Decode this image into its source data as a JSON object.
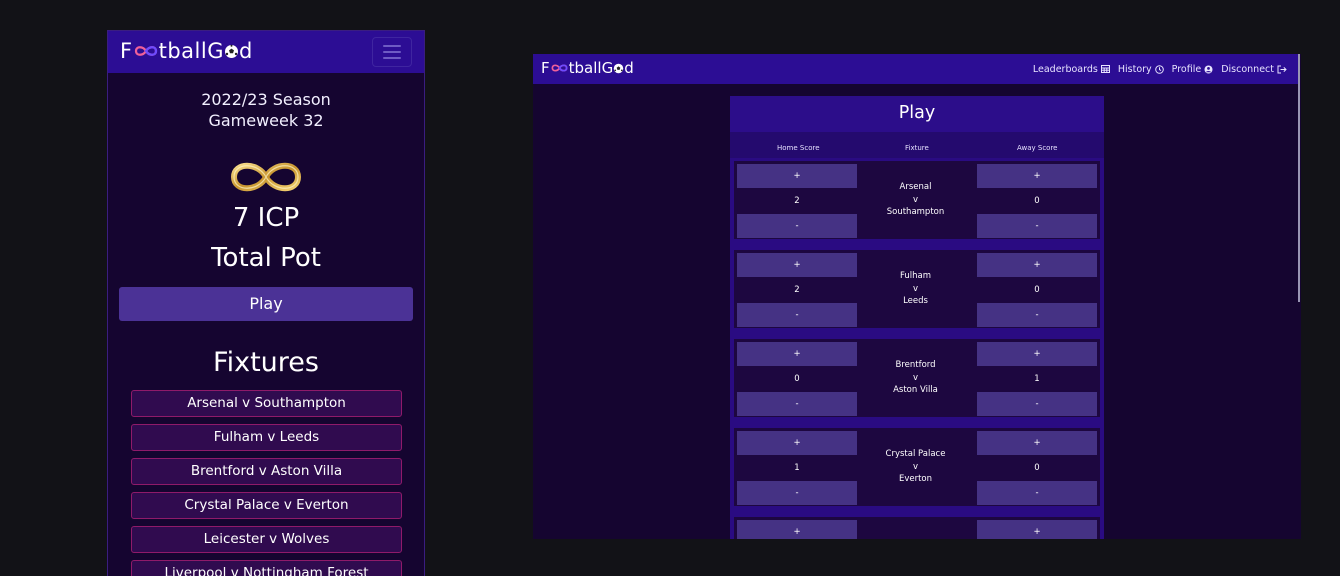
{
  "brand": {
    "name_prefix": "F",
    "name_mid": "tballG",
    "name_suffix": "d"
  },
  "mobile": {
    "season": "2022/23 Season",
    "gameweek": "Gameweek 32",
    "pot_amount": "7 ICP",
    "pot_label": "Total Pot",
    "play_label": "Play",
    "fixtures_title": "Fixtures",
    "fixtures": [
      "Arsenal v Southampton",
      "Fulham v Leeds",
      "Brentford v Aston Villa",
      "Crystal Palace v Everton",
      "Leicester v Wolves",
      "Liverpool v Nottingham Forest"
    ]
  },
  "desktop": {
    "nav": {
      "leaderboards": "Leaderboards",
      "history": "History",
      "profile": "Profile",
      "disconnect": "Disconnect"
    },
    "card_title": "Play",
    "col_home": "Home Score",
    "col_fixture": "Fixture",
    "col_away": "Away Score",
    "plus": "+",
    "minus": "-",
    "matches": [
      {
        "home": "Arsenal",
        "v": "v",
        "away": "Southampton",
        "home_score": "2",
        "away_score": "0"
      },
      {
        "home": "Fulham",
        "v": "v",
        "away": "Leeds",
        "home_score": "2",
        "away_score": "0"
      },
      {
        "home": "Brentford",
        "v": "v",
        "away": "Aston Villa",
        "home_score": "0",
        "away_score": "1"
      },
      {
        "home": "Crystal Palace",
        "v": "v",
        "away": "Everton",
        "home_score": "1",
        "away_score": "0"
      }
    ]
  },
  "colors": {
    "page_bg": "#121217",
    "nav_bg": "#2c0d94",
    "panel_bg": "#150530",
    "button_bg": "#4b3296",
    "fixture_border": "#8f1a6a",
    "gold": "#d4a73a"
  },
  "icons": [
    "menu-icon",
    "infinity-icon",
    "football-icon",
    "table-icon",
    "clock-icon",
    "user-icon",
    "sign-out-icon"
  ]
}
